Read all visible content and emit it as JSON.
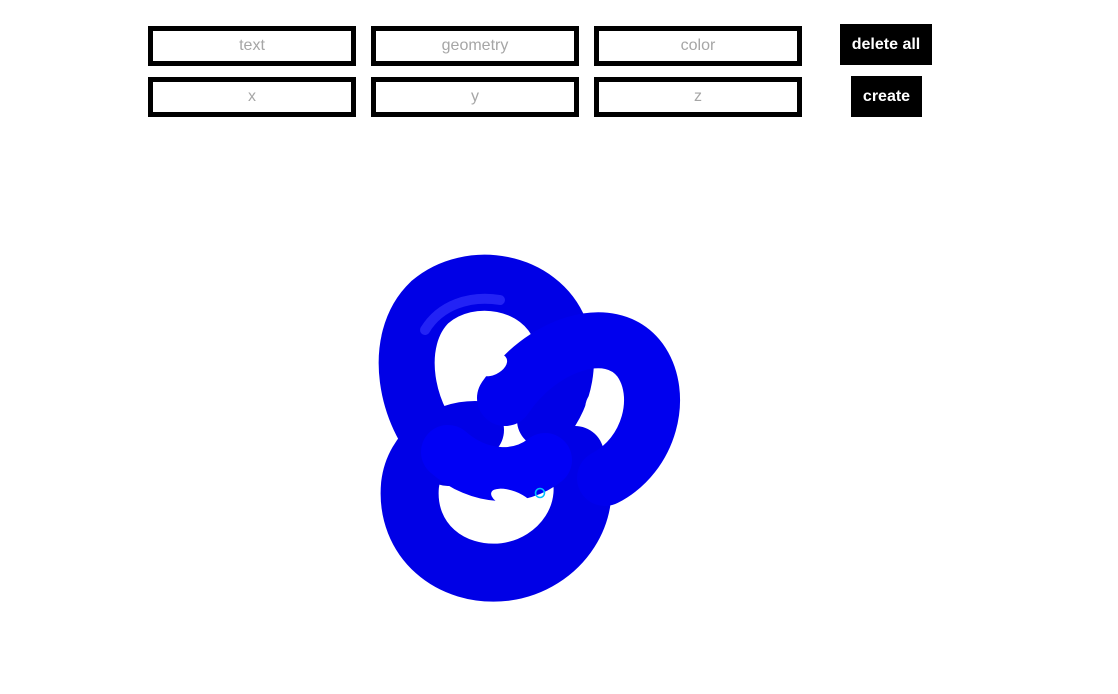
{
  "form": {
    "text_placeholder": "text",
    "geometry_placeholder": "geometry",
    "color_placeholder": "color",
    "x_placeholder": "x",
    "y_placeholder": "y",
    "z_placeholder": "z"
  },
  "buttons": {
    "delete_all_label": "delete all",
    "create_label": "create"
  },
  "scene": {
    "object": "torus-knot",
    "object_color": "#0000ff",
    "cursor_marker_color": "#00bfff"
  },
  "colors": {
    "field_border": "#000000",
    "placeholder_text": "#a6a6a6",
    "button_bg": "#000000",
    "button_text": "#ffffff"
  }
}
